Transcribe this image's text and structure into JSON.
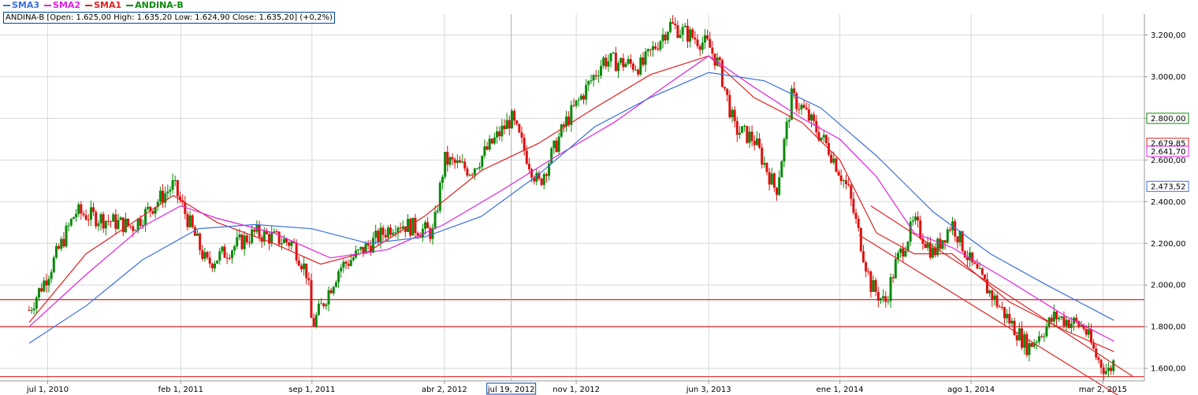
{
  "legend": [
    {
      "label": "SMA3",
      "color": "#3a6fdc"
    },
    {
      "label": "SMA2",
      "color": "#e020e0"
    },
    {
      "label": "SMA1",
      "color": "#e02020"
    },
    {
      "label": "ANDINA-B",
      "color": "#0a8a0a"
    }
  ],
  "ohlc_info": "ANDINA-B [Open: 1.625,00  High: 1.635,20  Low: 1.624,90  Close: 1.635,20] (+0,2%)",
  "crosshair_date_label": "jul 19, 2012",
  "price_tags": [
    {
      "value": "2.800,00",
      "color": "#0a8a0a"
    },
    {
      "value": "2.679,85",
      "color": "#e02020"
    },
    {
      "value": "2.641,70",
      "color": "#e020e0"
    },
    {
      "value": "2.473,52",
      "color": "#3a6fdc"
    }
  ],
  "chart_data": {
    "type": "line",
    "title": "",
    "xlabel": "",
    "ylabel": "",
    "ylim": [
      1540,
      3300
    ],
    "x_ticks": [
      "jul 1, 2010",
      "feb 1, 2011",
      "sep 1, 2011",
      "abr 2, 2012",
      "nov 1, 2012",
      "jun 3, 2013",
      "ene 1, 2014",
      "ago 1, 2014",
      "mar 2, 2015"
    ],
    "y_ticks": [
      "1.600,00",
      "1.800,00",
      "2.000,00",
      "2.200,00",
      "2.400,00",
      "2.600,00",
      "2.800,00",
      "3.000,00",
      "3.200,00"
    ],
    "y_tick_values": [
      1600,
      1800,
      2000,
      2200,
      2400,
      2600,
      2800,
      3000,
      3200
    ],
    "grid": true,
    "horizontal_lines": [
      1930,
      1800,
      1560
    ],
    "price_line_anchors": {
      "x": [
        "2010-06-01",
        "2010-07-01",
        "2010-08-15",
        "2010-11-15",
        "2011-01-20",
        "2011-03-15",
        "2011-06-01",
        "2011-08-01",
        "2011-08-25",
        "2011-09-01",
        "2011-10-15",
        "2011-11-15",
        "2012-01-15",
        "2012-03-15",
        "2012-04-02",
        "2012-05-15",
        "2012-07-19",
        "2012-09-01",
        "2012-10-15",
        "2012-12-15",
        "2013-02-15",
        "2013-04-01",
        "2013-06-03",
        "2013-06-20",
        "2013-07-15",
        "2013-08-15",
        "2013-09-20",
        "2013-10-15",
        "2013-11-01",
        "2013-12-15",
        "2014-01-15",
        "2014-02-20",
        "2014-03-15",
        "2014-04-01",
        "2014-05-01",
        "2014-06-01",
        "2014-07-01",
        "2014-08-01",
        "2014-09-15",
        "2014-11-01",
        "2014-12-15",
        "2015-01-30",
        "2015-02-20",
        "2015-03-10",
        "2015-03-20"
      ],
      "y": [
        1880,
        2050,
        2350,
        2280,
        2480,
        2100,
        2250,
        2200,
        2050,
        1800,
        2080,
        2150,
        2300,
        2250,
        2600,
        2550,
        2800,
        2480,
        2780,
        3080,
        3050,
        3250,
        3150,
        3050,
        2750,
        2700,
        2450,
        2900,
        2850,
        2650,
        2450,
        2000,
        1910,
        2100,
        2300,
        2150,
        2300,
        2100,
        1900,
        1700,
        1850,
        1800,
        1650,
        1580,
        1635
      ]
    },
    "series": [
      {
        "name": "SMA1",
        "color": "#e02020",
        "x": [
          "2010-06-01",
          "2010-09-01",
          "2010-12-01",
          "2011-01-20",
          "2011-04-01",
          "2011-07-01",
          "2011-09-15",
          "2011-12-01",
          "2012-03-01",
          "2012-06-01",
          "2012-09-01",
          "2012-12-01",
          "2013-03-01",
          "2013-06-03",
          "2013-08-15",
          "2013-11-01",
          "2014-01-01",
          "2014-03-01",
          "2014-05-01",
          "2014-07-01",
          "2014-10-01",
          "2015-01-01",
          "2015-03-20"
        ],
        "y": [
          1820,
          2150,
          2330,
          2430,
          2300,
          2200,
          2100,
          2160,
          2330,
          2550,
          2680,
          2850,
          3010,
          3100,
          2900,
          2780,
          2600,
          2250,
          2150,
          2150,
          1920,
          1780,
          1680
        ]
      },
      {
        "name": "SMA2",
        "color": "#e020e0",
        "x": [
          "2010-06-01",
          "2010-09-01",
          "2010-12-01",
          "2011-02-01",
          "2011-04-01",
          "2011-07-01",
          "2011-10-01",
          "2012-01-01",
          "2012-04-01",
          "2012-07-01",
          "2012-10-01",
          "2013-01-01",
          "2013-04-01",
          "2013-06-03",
          "2013-08-15",
          "2013-11-01",
          "2014-01-01",
          "2014-03-01",
          "2014-05-01",
          "2014-07-01",
          "2014-10-01",
          "2015-01-01",
          "2015-03-20"
        ],
        "y": [
          1800,
          2050,
          2280,
          2380,
          2320,
          2250,
          2130,
          2170,
          2290,
          2450,
          2620,
          2780,
          2970,
          3100,
          2950,
          2800,
          2700,
          2520,
          2250,
          2180,
          2020,
          1850,
          1730
        ]
      },
      {
        "name": "SMA3",
        "color": "#3a6fdc",
        "x": [
          "2010-06-01",
          "2010-09-01",
          "2010-12-01",
          "2011-03-01",
          "2011-06-01",
          "2011-09-01",
          "2011-12-01",
          "2012-03-01",
          "2012-06-01",
          "2012-09-01",
          "2012-12-01",
          "2013-03-01",
          "2013-06-03",
          "2013-09-01",
          "2013-12-01",
          "2014-03-01",
          "2014-06-01",
          "2014-09-01",
          "2014-12-01",
          "2015-03-20"
        ],
        "y": [
          1720,
          1900,
          2120,
          2270,
          2290,
          2270,
          2200,
          2230,
          2330,
          2530,
          2760,
          2900,
          3020,
          2980,
          2850,
          2620,
          2350,
          2150,
          2000,
          1830
        ]
      }
    ],
    "trend_lines": [
      {
        "x": [
          "2014-02-20",
          "2015-04-20"
        ],
        "y": [
          2380,
          1560
        ]
      },
      {
        "x": [
          "2014-02-01",
          "2015-04-01"
        ],
        "y": [
          2240,
          1460
        ]
      }
    ]
  }
}
